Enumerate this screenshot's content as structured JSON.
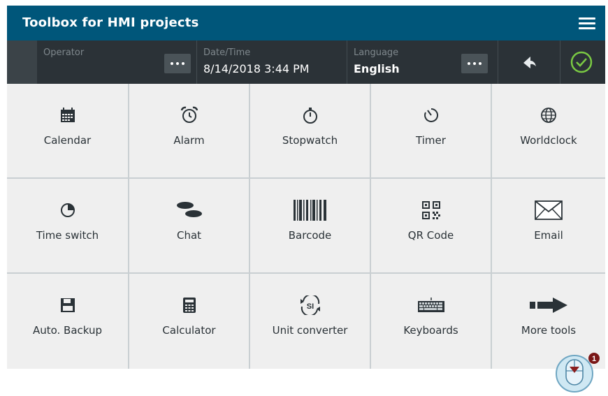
{
  "app": {
    "title": "Toolbox for HMI projects"
  },
  "status": {
    "operator_label": "Operator",
    "datetime_label": "Date/Time",
    "datetime_value": "8/14/2018 3:44 PM",
    "language_label": "Language",
    "language_value": "English"
  },
  "tiles": [
    {
      "label": "Calendar",
      "icon": "calendar-icon"
    },
    {
      "label": "Alarm",
      "icon": "alarm-clock-icon"
    },
    {
      "label": "Stopwatch",
      "icon": "stopwatch-icon"
    },
    {
      "label": "Timer",
      "icon": "timer-icon"
    },
    {
      "label": "Worldclock",
      "icon": "globe-icon"
    },
    {
      "label": "Time switch",
      "icon": "time-switch-icon"
    },
    {
      "label": "Chat",
      "icon": "chat-icon"
    },
    {
      "label": "Barcode",
      "icon": "barcode-icon"
    },
    {
      "label": "QR Code",
      "icon": "qr-code-icon"
    },
    {
      "label": "Email",
      "icon": "envelope-icon"
    },
    {
      "label": "Auto. Backup",
      "icon": "floppy-disk-icon"
    },
    {
      "label": "Calculator",
      "icon": "calculator-icon"
    },
    {
      "label": "Unit converter",
      "icon": "unit-converter-icon"
    },
    {
      "label": "Keyboards",
      "icon": "keyboard-icon"
    },
    {
      "label": "More tools",
      "icon": "arrow-right-icon"
    }
  ],
  "callout": {
    "number": "1"
  },
  "colors": {
    "header": "#00567a",
    "statusbar": "#2b3237",
    "ok_green": "#7ac943",
    "tile": "#efefef"
  }
}
